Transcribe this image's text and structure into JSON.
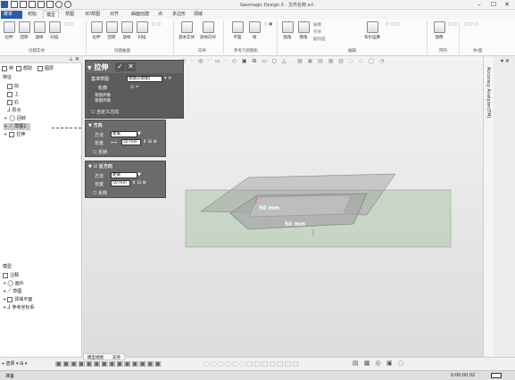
{
  "window": {
    "title": "Geomagic Design X - 文件名称.xrl",
    "controls": [
      "–",
      "☐",
      "✕"
    ]
  },
  "tabs": [
    "菜单",
    "初始",
    "模型",
    "草图",
    "3D草图",
    "对齐",
    "曲面创建",
    "点",
    "多边形",
    "领域"
  ],
  "ribbon": {
    "group1": {
      "label": "创建实体",
      "buttons": [
        "拉伸",
        "回转",
        "放样",
        "扫描"
      ]
    },
    "group2": {
      "label": "创建曲面",
      "buttons": [
        "拉伸",
        "回转",
        "放样",
        "扫描"
      ]
    },
    "group3": {
      "label": "向导",
      "buttons": [
        "基本实体",
        "放样向导"
      ]
    },
    "group4": {
      "label": "参考几何图形",
      "buttons": [
        "平面",
        "线"
      ]
    },
    "group5": {
      "label": "编辑",
      "buttons": [
        "圆角",
        "倒角",
        "拔模",
        "壳体",
        "删除面",
        "布尔运算"
      ]
    },
    "group6": {
      "label": "阵列",
      "buttons": [
        "镜像"
      ]
    },
    "group7": {
      "label": "体/面",
      "buttons": []
    }
  },
  "left_panel": {
    "top_tabs": [
      "特",
      "帮助",
      "图层"
    ],
    "tree_title": "特征",
    "tree_items": [
      "前",
      "上",
      "右",
      "原点",
      "回转",
      "草图1",
      "拉伸"
    ],
    "bottom_title": "模型",
    "bottom_items": [
      "注释",
      "面片",
      "草图",
      "领域平面",
      "参考坐标系"
    ]
  },
  "extrude_dialog": {
    "title": "拉伸",
    "ok": "✓",
    "cancel": "✕",
    "section_profile": "基准草图",
    "profile_value": "草图1(草图)",
    "section_outline": "轮廓",
    "outline_item1": "草图环路",
    "outline_item2": "草图环路",
    "custom_direction": "自定义方向"
  },
  "direction_panel": {
    "title": "方向",
    "method_label": "方法",
    "method_value": "距离",
    "length_label": "长度",
    "length_value": "50 mm",
    "reverse_label": "反转"
  },
  "reverse_panel": {
    "title": "反方向",
    "method_label": "方法",
    "method_value": "距离",
    "length_label": "长度",
    "length_value": "50 mm",
    "reverse_label": "反转"
  },
  "viewport": {
    "dimension_top": "50 mm",
    "dimension_bottom": "50 mm"
  },
  "right_panel": {
    "label": "Accuracy Analyzer(TM)"
  },
  "bottom_tabs": [
    "模型视图",
    "支持"
  ],
  "status": {
    "left_text": "准备",
    "right_text": "0:00:00.02"
  },
  "colors": {
    "accent": "#2a5ca8",
    "dialog_bg": "#6b6b6b",
    "plane": "#8fb68a",
    "part": "#a3a3a3"
  }
}
